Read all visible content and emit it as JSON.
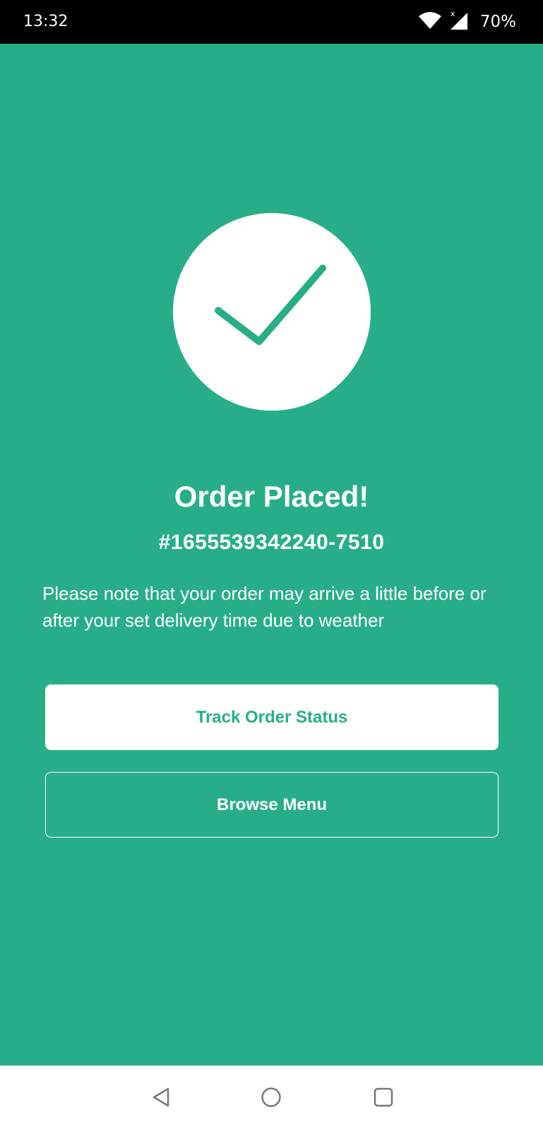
{
  "status_bar": {
    "time": "13:32",
    "battery": "70%",
    "icons": [
      "wifi-icon",
      "signal-icon",
      "battery-text"
    ]
  },
  "confirmation": {
    "icon": "check-icon",
    "title": "Order Placed!",
    "order_number": "#1655539342240-7510",
    "note": "Please note that your order may arrive a little before or after your set delivery time due to weather"
  },
  "actions": {
    "track_label": "Track Order Status",
    "browse_label": "Browse Menu"
  },
  "nav_bar": {
    "icons": [
      "back-icon",
      "home-icon",
      "recents-icon"
    ]
  },
  "colors": {
    "accent": "#27AE88",
    "status_bar_bg": "#000000",
    "nav_bar_bg": "#FFFFFF",
    "text_on_accent": "#FFFFFF"
  }
}
